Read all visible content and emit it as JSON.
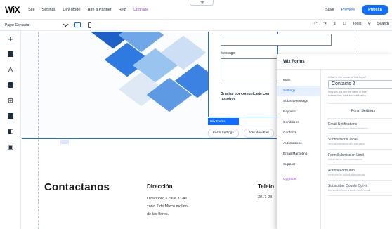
{
  "topbar": {
    "logo": "WiX",
    "menu": [
      "Site",
      "Settings",
      "Dev Mode",
      "Hire a Partner",
      "Help"
    ],
    "upgrade": "Upgrade",
    "save": "Save",
    "preview": "Preview",
    "publish": "Publish"
  },
  "toolbar": {
    "page": "Page: Contacto",
    "tools": "Tools",
    "search": "Search"
  },
  "canvas": {
    "message_label": "Message",
    "gracias": "Gracias por comunicarte con nosotros",
    "form_tag": "Wix Forms",
    "form_settings": "Form Settings",
    "add_new_field": "Add New Fiel",
    "section_title": "Contactanos",
    "direccion_title": "Dirección",
    "direccion_lines": [
      "Dirección: 3 calle 31-46",
      "zona 2 de Mixco molino",
      "de las flores."
    ],
    "telefono_title": "Telefo",
    "telefono_number": "3017-28"
  },
  "panel": {
    "title": "Wix Forms",
    "nav": [
      "Main",
      "Settings",
      "Submit Message",
      "Payment",
      "Conditions",
      "Contacts",
      "Automations",
      "Email Marketing",
      "Support",
      "Upgrade"
    ],
    "active_nav": "Settings",
    "name_question": "What is the name of this form?",
    "name_value": "Contacts 2",
    "name_hint": [
      "Only you will see the name in your",
      "submissions table and notification"
    ],
    "form_settings_title": "Form Settings",
    "settings": [
      {
        "title": "Email Notifications",
        "desc": "Get notified of each form submission"
      },
      {
        "title": "Submissions Table",
        "desc": "View all submissions in one place"
      },
      {
        "title": "Form Submission Limit",
        "desc": "Set a limit for form submissions"
      },
      {
        "title": "Autofill Form Info",
        "desc": "Fill in info for visitors automatically"
      },
      {
        "title": "Subscriber Double Opt-In",
        "desc": "Send subscribers a confirmation email"
      }
    ]
  },
  "colors": {
    "accent": "#116dff",
    "upgrade": "#a34ad6",
    "panel_active_bg": "#e7f0ff"
  }
}
